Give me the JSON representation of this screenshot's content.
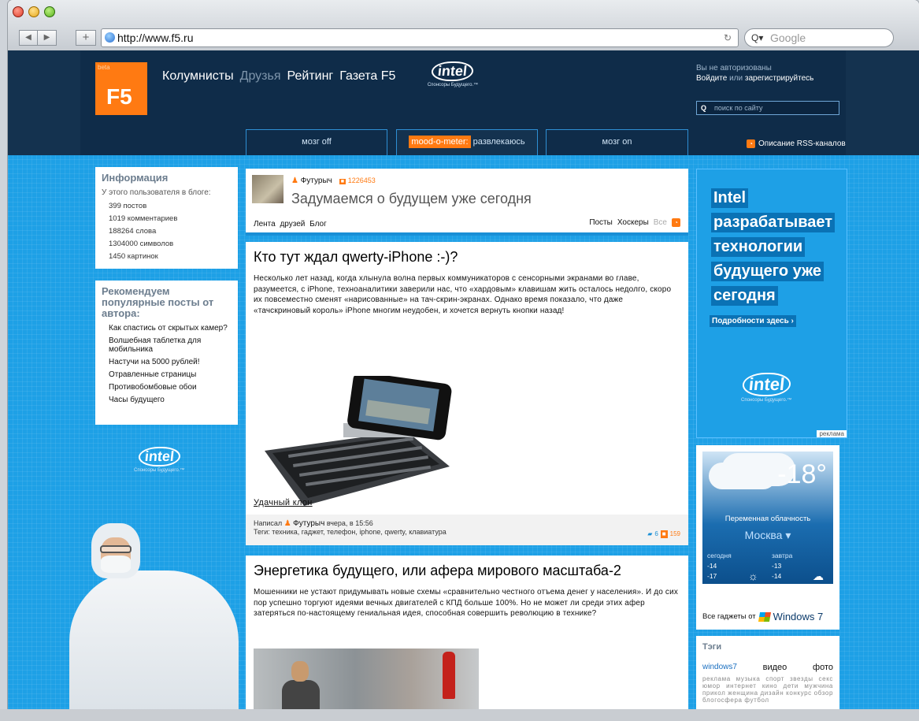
{
  "browser": {
    "url": "http://www.f5.ru",
    "search_placeholder": "Google",
    "search_glyph": "Q▾"
  },
  "header": {
    "beta": "beta",
    "logo": "F5",
    "nav": [
      "Колумнисты",
      "Друзья",
      "Рейтинг",
      "Газета F5"
    ],
    "intel_logo": "intel",
    "intel_slogan": "Спонсоры Будущего.™",
    "auth_line1": "Вы не авторизованы",
    "auth_login": "Войдите",
    "auth_or": "или",
    "auth_register": "зарегистрируйтесь",
    "search_q": "Q",
    "search_placeholder": "поиск по сайту",
    "tab_off": "мозг off",
    "tab_mood_badge": "mood-o-meter:",
    "tab_mood_value": "развлекаюсь",
    "tab_on": "мозг on",
    "rss_label": "Описание RSS-каналов"
  },
  "info": {
    "title": "Информация",
    "subtitle": "У этого пользователя в блоге:",
    "stats": [
      "399 постов",
      "1019 комментариев",
      "188264 слова",
      "1304000 символов",
      "1450 картинок"
    ]
  },
  "recommend": {
    "title": "Рекомендуем популярные посты от автора:",
    "items": [
      "Как спастись от скрытых камер?",
      "Волшебная таблетка для мобильника",
      "Настучи на 5000 рублей!",
      "Отравленные страницы",
      "Противобомбовые обои",
      "Часы будущего"
    ]
  },
  "profile": {
    "username": "Футурыч",
    "rank_label": "■",
    "rank": "1226453",
    "headline": "Задумаемся о будущем уже сегодня",
    "link_feed": "Лента друзей",
    "link_blog": "Блог",
    "link_posts": "Посты",
    "link_hoskers": "Хоскеры",
    "link_all": "Все"
  },
  "post1": {
    "title": "Кто тут ждал qwerty-iPhone :-)?",
    "body": "Несколько лет назад, когда хлынула волна первых коммуникаторов с сенсорными экранами во главе, разумеется, с iPhone, техноаналитики заверили нас, что «хардовым» клавишам жить осталось недолго, скоро их повсеместно сменят «нарисованные» на тач-скрин-экранах. Однако время показало, что даже «тачскриновый король» iPhone многим неудобен, и хочется вернуть кнопки назад!",
    "caption": "Удачный клон",
    "meta_wrote": "Написал",
    "meta_author": "Футурыч",
    "meta_time": "вчера, в 15:56",
    "meta_tags": "Теги: техника, гаджет, телефон, iphone, qwerty, клавиатура",
    "comments": "6",
    "rating": "159"
  },
  "post2": {
    "title": "Энергетика будущего, или афера мирового масштаба-2",
    "body": "Мошенники не устают придумывать новые схемы «сравнительно честного отъема денег у населения». И до сих пор успешно торгуют идеями вечных двигателей с КПД больше 100%. Но не может ли среди этих афер затеряться по-настоящему гениальная идея, способная совершить революцию в технике?"
  },
  "ad": {
    "lines": [
      "Intel",
      "разрабатывает",
      "технологии",
      "будущего уже",
      "сегодня"
    ],
    "more": "Подробности здесь ›",
    "logo": "intel",
    "slogan": "Спонсоры Будущего.™",
    "label": "реклама"
  },
  "weather": {
    "temp": "-18°",
    "condition": "Переменная облачность",
    "city": "Москва",
    "today_label": "сегодня",
    "today_hi": "-14",
    "today_lo": "-17",
    "tomorrow_label": "завтра",
    "tomorrow_hi": "-13",
    "tomorrow_lo": "-14",
    "today_icon": "sun-icon",
    "tomorrow_icon": "cloud-icon",
    "footer": "Все гаджеты от",
    "footer_brand": "Windows 7"
  },
  "tags": {
    "title": "Тэги",
    "big": [
      "windows7",
      "видео",
      "фото"
    ],
    "small": "реклама музыка спорт звезды секс юмор интернет кино дети мужчина прикол женщина дизайн конкурс обзор блогосфера футбол"
  },
  "colors": {
    "brand": "#ff7a12",
    "page_bg": "#1ea0e6",
    "header_bg": "#0f2c49"
  }
}
